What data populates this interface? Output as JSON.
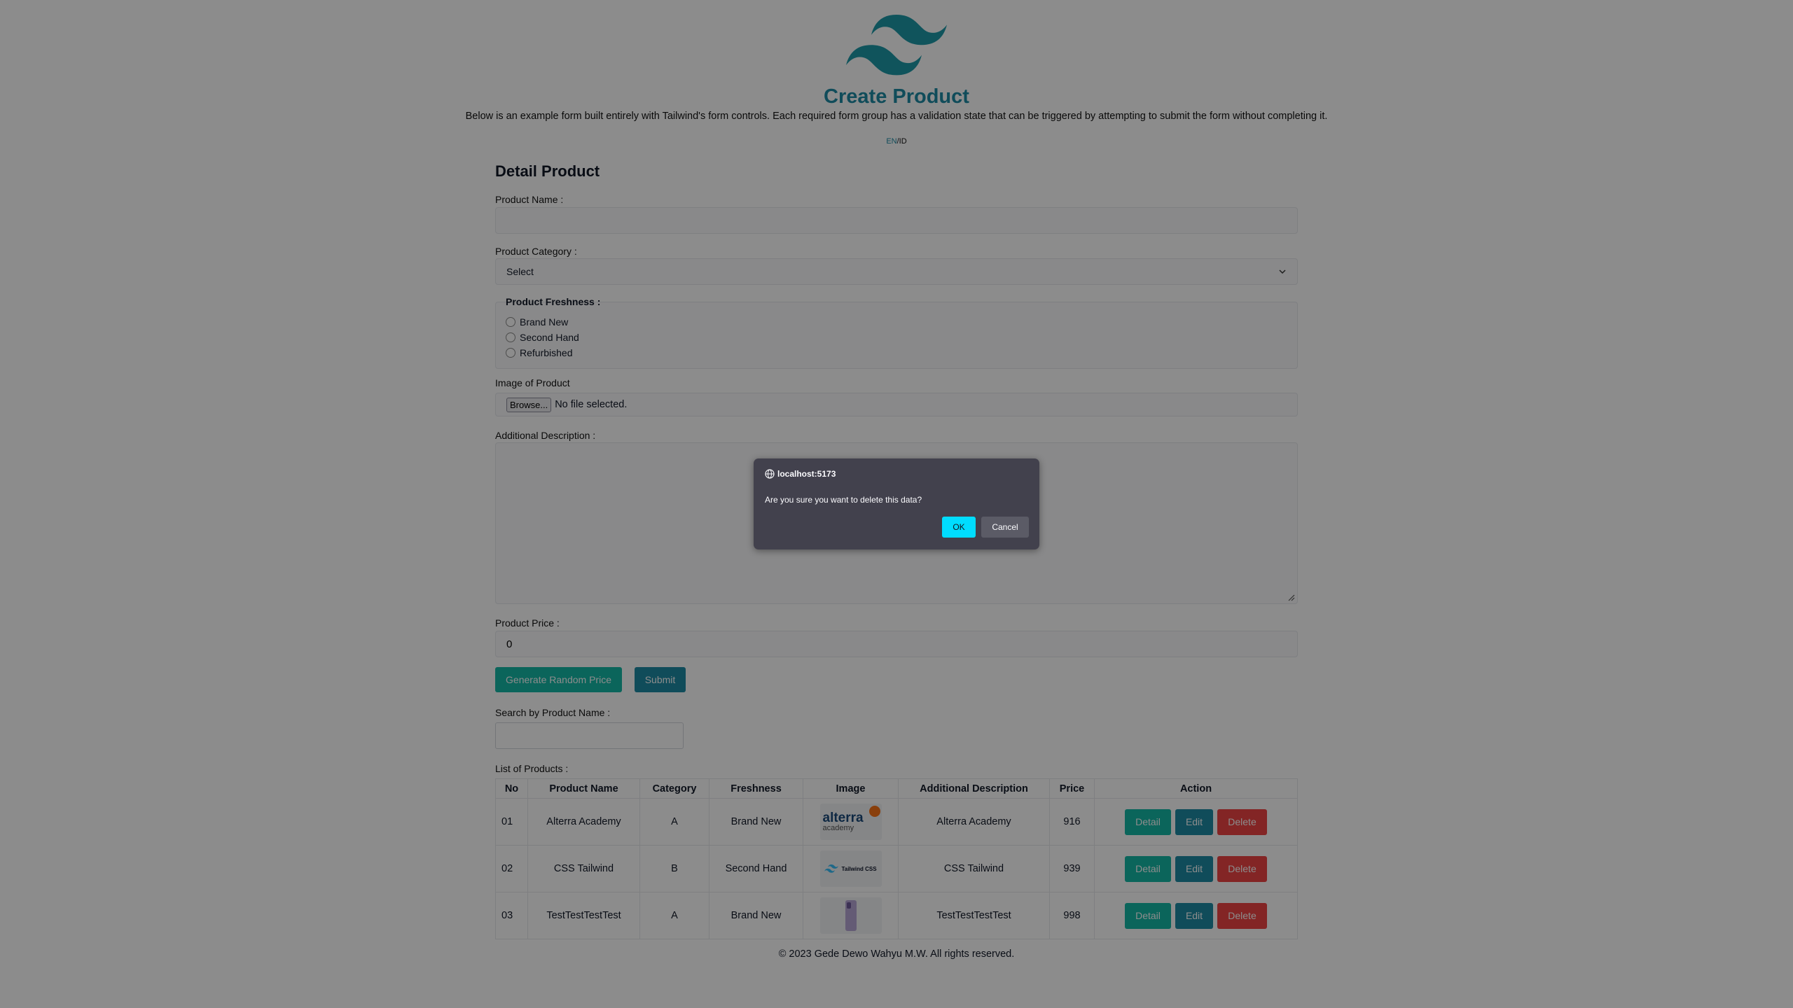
{
  "header": {
    "logo_icon": "tailwind-logo",
    "title": "Create Product",
    "subtitle": "Below is an example form built entirely with Tailwind's form controls. Each required form group has a validation state that can be triggered by attempting to submit the form without completing it.",
    "lang_en": "EN",
    "lang_sep": "/",
    "lang_id": "ID"
  },
  "form": {
    "section_title": "Detail Product",
    "product_name_label": "Product Name :",
    "product_name_value": "",
    "category_label": "Product Category :",
    "category_selected": "Select",
    "freshness_label": "Product Freshness :",
    "freshness_options": [
      "Brand New",
      "Second Hand",
      "Refurbished"
    ],
    "image_label": "Image of Product",
    "browse_label": "Browse...",
    "file_status": "No file selected.",
    "description_label": "Additional Description :",
    "price_label": "Product Price :",
    "price_value": "0",
    "generate_label": "Generate Random Price",
    "submit_label": "Submit"
  },
  "search": {
    "label": "Search by Product Name :",
    "value": ""
  },
  "products": {
    "label": "List of Products :",
    "columns": [
      "No",
      "Product Name",
      "Category",
      "Freshness",
      "Image",
      "Additional Description",
      "Price",
      "Action"
    ],
    "rows": [
      {
        "no": "01",
        "name": "Alterra Academy",
        "category": "A",
        "freshness": "Brand New",
        "image_text": "alterra",
        "image_sub": "academy",
        "description": "Alterra Academy",
        "price": "916"
      },
      {
        "no": "02",
        "name": "CSS Tailwind",
        "category": "B",
        "freshness": "Second Hand",
        "image_text": "Tailwind CSS",
        "image_sub": "",
        "description": "CSS Tailwind",
        "price": "939"
      },
      {
        "no": "03",
        "name": "TestTestTestTest",
        "category": "A",
        "freshness": "Brand New",
        "image_text": "",
        "image_sub": "",
        "description": "TestTestTestTest",
        "price": "998"
      }
    ],
    "detail_label": "Detail",
    "edit_label": "Edit",
    "delete_label": "Delete"
  },
  "footer": {
    "text": "© 2023 Gede Dewo Wahyu M.W. All rights reserved."
  },
  "dialog": {
    "origin": "localhost:5173",
    "message": "Are you sure you want to delete this data?",
    "ok_label": "OK",
    "cancel_label": "Cancel"
  },
  "colors": {
    "accent": "#1e8aa4",
    "teal": "#14b8a6",
    "danger": "#ef4444",
    "dialog_bg": "#42414d",
    "dialog_ok": "#00ddff"
  }
}
